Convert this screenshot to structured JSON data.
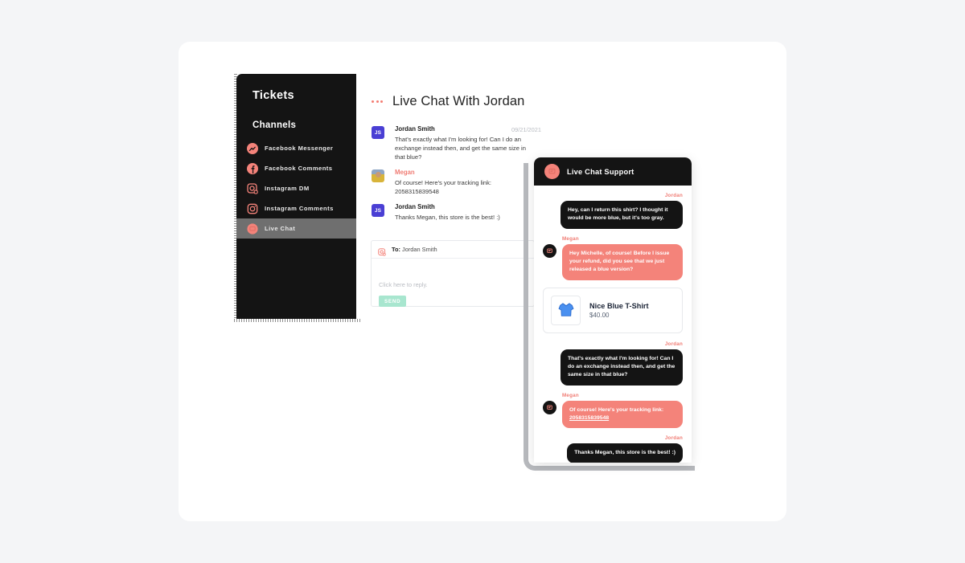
{
  "theme": {
    "page_background": "#f4f5f7",
    "card_background": "#ffffff",
    "sidebar_background": "#141414",
    "accent_coral": "#f4837a",
    "accent_name_coral": "#f07c74",
    "send_button_green": "#a8e6cf",
    "avatar_purple": "#4a3fd4"
  },
  "sidebar": {
    "title": "Tickets",
    "section_label": "Channels",
    "items": [
      {
        "label": "Facebook Messenger",
        "icon": "facebook-messenger-icon",
        "active": false
      },
      {
        "label": "Facebook Comments",
        "icon": "facebook-icon",
        "active": false
      },
      {
        "label": "Instagram DM",
        "icon": "instagram-dm-icon",
        "active": false
      },
      {
        "label": "Instagram Comments",
        "icon": "instagram-icon",
        "active": false
      },
      {
        "label": "Live Chat",
        "icon": "live-chat-icon",
        "active": true
      }
    ]
  },
  "conversation": {
    "menu_icon": "more-options-icon",
    "title": "Live Chat With Jordan",
    "date": "09/21/2021",
    "messages": [
      {
        "avatar_type": "initials",
        "avatar_text": "JS",
        "sender": "Jordan Smith",
        "sender_color": "dark",
        "body": "That's exactly what I'm looking for! Can I do an exchange instead then, and get the same size in that blue?"
      },
      {
        "avatar_type": "photo",
        "avatar_text": "",
        "sender": "Megan",
        "sender_color": "coral",
        "body": "Of course! Here's your tracking link: 2058315839548"
      },
      {
        "avatar_type": "initials",
        "avatar_text": "JS",
        "sender": "Jordan Smith",
        "sender_color": "dark",
        "body": "Thanks Megan, this store is the best! :)"
      }
    ],
    "reply": {
      "to_icon": "instagram-dm-icon",
      "to_prefix": "To:",
      "to_recipient": "Jordan Smith",
      "placeholder": "Click here to reply.",
      "send_label": "SEND"
    }
  },
  "phone_widget": {
    "header_icon": "chat-bubble-icon",
    "header_title": "Live Chat Support",
    "messages": [
      {
        "sender": "Jordan",
        "side": "right",
        "style": "dark",
        "text": "Hey, can I return this shirt? I thought it would be more blue, but it's too gray.",
        "avatar": false
      },
      {
        "sender": "Megan",
        "side": "left",
        "style": "coral",
        "text": "Hey Michelle, of course! Before I issue your refund, did you see that we just released a blue version?",
        "avatar": true,
        "avatar_icon": "chat-bubble-icon"
      },
      {
        "sender": "Jordan",
        "side": "right",
        "style": "dark",
        "text": "That's exactly what I'm looking for! Can I do an exchange instead then, and get the same size in that blue?",
        "avatar": false
      },
      {
        "sender": "Megan",
        "side": "left",
        "style": "coral",
        "text": "Of course! Here's your tracking link: ",
        "link_text": "2058315839548",
        "avatar": true,
        "avatar_icon": "chat-bubble-icon"
      },
      {
        "sender": "Jordan",
        "side": "right",
        "style": "dark",
        "text": "Thanks Megan, this store is the best! :)",
        "avatar": false
      }
    ],
    "product": {
      "thumb_icon": "blue-tshirt-icon",
      "name": "Nice Blue T-Shirt",
      "price": "$40.00"
    }
  }
}
